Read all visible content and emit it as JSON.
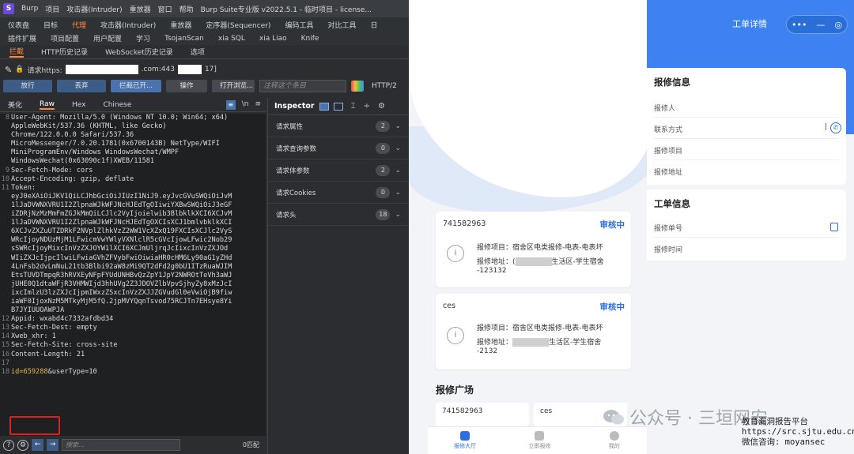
{
  "burp": {
    "app_icon": "S",
    "menubar": [
      "Burp",
      "项目",
      "攻击器(Intruder)",
      "重放器",
      "窗口",
      "帮助",
      "Burp Suite专业版 v2022.5.1 - 临时项目 - license..."
    ],
    "toolrow1": [
      "仪表盘",
      "目标",
      "代理",
      "攻击器(Intruder)",
      "重放器",
      "定序器(Sequencer)",
      "编码工具",
      "对比工具",
      "日"
    ],
    "toolrow1_active": "代理",
    "toolrow2": [
      "插件扩展",
      "项目配置",
      "用户配置",
      "学习",
      "TsojanScan",
      "xia SQL",
      "xia Liao",
      "Knife"
    ],
    "subtabs": [
      "拦截",
      "HTTP历史记录",
      "WebSocket历史记录",
      "选项"
    ],
    "subtabs_active": "拦截",
    "request_prefix": "请求https:",
    "request_mid": ".com:443",
    "request_suffix": "17]",
    "buttons": {
      "forward": "放行",
      "drop": "丢弃",
      "intercept": "拦截已开...",
      "action": "操作",
      "open_browser": "打开浏览..."
    },
    "comment_placeholder": "注释这个条目",
    "protocol": "HTTP/2",
    "editor_tabs": [
      "美化",
      "Raw",
      "Hex",
      "Chinese"
    ],
    "editor_tabs_active": "Raw",
    "editor_lines": [
      {
        "n": "8",
        "t": "User-Agent: Mozilla/5.0 (Windows NT 10.0; Win64; x64)"
      },
      {
        "n": "",
        "t": "AppleWebKit/537.36 (KHTML, like Gecko)"
      },
      {
        "n": "",
        "t": "Chrome/122.0.0.0 Safari/537.36"
      },
      {
        "n": "",
        "t": "MicroMessenger/7.0.20.1781(0x6700143B) NetType/WIFI"
      },
      {
        "n": "",
        "t": "MiniProgramEnv/Windows WindowsWechat/WMPF"
      },
      {
        "n": "",
        "t": "WindowsWechat(0x63090c1f)XWEB/11581"
      },
      {
        "n": "9",
        "t": "Sec-Fetch-Mode: cors"
      },
      {
        "n": "10",
        "t": "Accept-Encoding: gzip, deflate"
      },
      {
        "n": "11",
        "t": "Token:"
      },
      {
        "n": "",
        "t": "eyJ0eXAiOiJKV1QiLCJhbGciOiJIUzI1NiJ9.eyJvcGVuSWQiOiJvM"
      },
      {
        "n": "",
        "t": "1lJaDVWNXVRU1I2ZlpnaWJkWFJNcHJEdTgOIiwiYXBwSWQiOiJ3eGF"
      },
      {
        "n": "",
        "t": "iZDRjNzMzMmFmZGJkMmQiLCJlc2VyIjoielwib3BlbklkXCI6XCJvM"
      },
      {
        "n": "",
        "t": "1lJaDVWNXVRU1I2ZlpnaWJkWFJNcHJEdTgOXCIsXCJ1bmlvbklkXCI"
      },
      {
        "n": "",
        "t": "6XCJvZXZuUTZDRkF2NVplZlhkVzZ2WW1VcXZxQ19FXCIsXCJlc2VyS"
      },
      {
        "n": "",
        "t": "WRcIjoyNDUzMjM1LFwicmVwYWlyVXNlclR5cGVcIjowLFwic2Nob29"
      },
      {
        "n": "",
        "t": "sSWRcIjoyMixcInVzZXJOYW1lXCI6XCJmUljrqJcIixcInVzZXJOd"
      },
      {
        "n": "",
        "t": "WIiZXJcIjpcIlwiLFwiaGVhZFVybFwiOiwiaHR0cHM6Ly90aG1yZHd"
      },
      {
        "n": "",
        "t": "4LnFsb2dvLmNuL21tb3Blbi92aW8zMi9QT2dFd2g0bU1ITzRuaWJIM"
      },
      {
        "n": "",
        "t": "EtsTUVDTmpqR3hRVXEyNFpFYUdUNHBvQzZpY1JpY2NWROtTeVh3aWJ"
      },
      {
        "n": "",
        "t": "jUHE0Q1dtaWFjR3VHMWIjd3hhUVg2Z3JDOVZlbVpvSjhyZy8xMzJcI"
      },
      {
        "n": "",
        "t": "ixcImlzU3lzZXJcIjpmIWxzZSxcInVzZXJJZGVudGl0eVwiOjB9fiw"
      },
      {
        "n": "",
        "t": "iaWF0IjoxNzM5MTkyMjM5fQ.2jpMVYQqnTsvod75RCJTn7EHsye8Yi"
      },
      {
        "n": "",
        "t": "B7JYIUUOAWPJA"
      },
      {
        "n": "12",
        "t": "Appid: wxabd4c7332afdbd34"
      },
      {
        "n": "13",
        "t": "Sec-Fetch-Dest: empty"
      },
      {
        "n": "14",
        "t": "Xweb_xhr: 1"
      },
      {
        "n": "15",
        "t": "Sec-Fetch-Site: cross-site"
      },
      {
        "n": "16",
        "t": "Content-Length: 21"
      },
      {
        "n": "17",
        "t": ""
      },
      {
        "n": "18",
        "t": ""
      }
    ],
    "body_id": "id=659288",
    "body_rest": "&userType=10",
    "search_placeholder": "搜索...",
    "matches": "0匹配",
    "inspector_title": "Inspector",
    "inspector_items": [
      {
        "label": "请求属性",
        "count": "2"
      },
      {
        "label": "请求查询参数",
        "count": "0"
      },
      {
        "label": "请求体参数",
        "count": "2"
      },
      {
        "label": "请求Cookies",
        "count": "0"
      },
      {
        "label": "请求头",
        "count": "18"
      }
    ]
  },
  "list": {
    "cards": [
      {
        "id": "741582963",
        "status": "审核中",
        "item_label": "报修项目：",
        "item": "宿舍区电类报修-电表-电表坏",
        "addr_label": "报修地址：",
        "addr_prefix": "(",
        "addr_suffix": "生活区-学生宿舍",
        "addr_line2": "-123132"
      },
      {
        "id": "ces",
        "status": "审核中",
        "item_label": "报修项目：",
        "item": "宿舍区电类报修-电表-电表坏",
        "addr_label": "报修地址：",
        "addr_prefix": "",
        "addr_suffix": "生活区-学生宿舍",
        "addr_line2": "-2132"
      }
    ],
    "square_title": "报修广场",
    "mini_cards": [
      "741582963",
      "ces"
    ],
    "tabs": [
      "报修大厅",
      "立即报修",
      "我的"
    ]
  },
  "detail": {
    "header_title": "工单详情",
    "capsule": {
      "more": "•••",
      "minimize": "—",
      "close": "◎"
    },
    "section1": "报修信息",
    "fields1": [
      "报修人",
      "联系方式",
      "报修项目",
      "报修地址"
    ],
    "phone_sep": "|",
    "section2": "工单信息",
    "fields2": [
      "报修单号",
      "报修时间"
    ]
  },
  "watermark": {
    "gzh_text": "公众号 · 三垣网安",
    "ad_lines": [
      "教育漏洞报告平台",
      "https://src.sjtu.edu.cn/",
      "微信咨询: moyansec"
    ]
  },
  "colors": {
    "accent": "#ff8a3d",
    "burp_bg": "#2b2d30",
    "blue": "#3d82f0",
    "status_blue": "#2d6fe0",
    "highlight_red": "#e02020"
  }
}
